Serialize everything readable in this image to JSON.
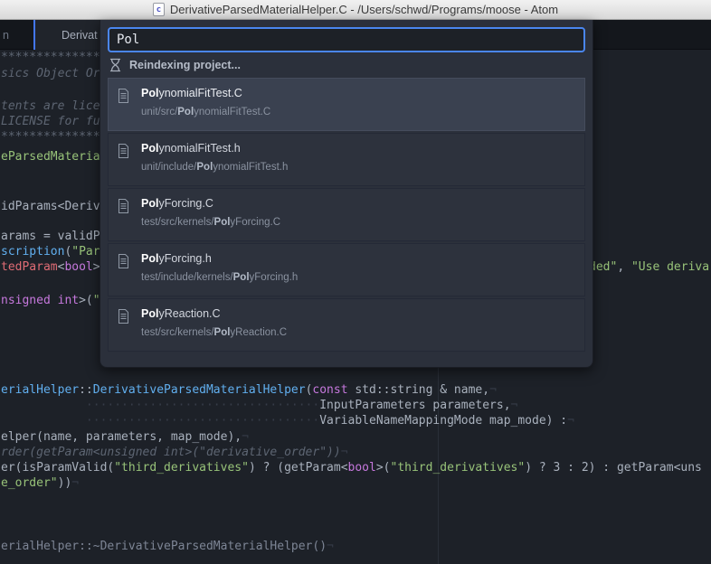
{
  "title_bar": {
    "title": "DerivativeParsedMaterialHelper.C - /Users/schwd/Programs/moose - Atom",
    "icon_letter": "c"
  },
  "tab_bar": {
    "left_tab_fragment": "n",
    "active_tab_fragment": "Derivat"
  },
  "finder": {
    "query": "Pol",
    "status": "Reindexing project...",
    "results": [
      {
        "selected": true,
        "match": "Pol",
        "rest": "ynomialFitTest.C",
        "dir": "unit/src/",
        "path_match": "Pol",
        "path_rest": "ynomialFitTest.C"
      },
      {
        "selected": false,
        "match": "Pol",
        "rest": "ynomialFitTest.h",
        "dir": "unit/include/",
        "path_match": "Pol",
        "path_rest": "ynomialFitTest.h"
      },
      {
        "selected": false,
        "match": "Pol",
        "rest": "yForcing.C",
        "dir": "test/src/kernels/",
        "path_match": "Pol",
        "path_rest": "yForcing.C"
      },
      {
        "selected": false,
        "match": "Pol",
        "rest": "yForcing.h",
        "dir": "test/include/kernels/",
        "path_match": "Pol",
        "path_rest": "yForcing.h"
      },
      {
        "selected": false,
        "match": "Pol",
        "rest": "yReaction.C",
        "dir": "test/src/kernels/",
        "path_match": "Pol",
        "path_rest": "yReaction.C"
      }
    ]
  },
  "editor": {
    "lines": [
      {
        "segments": [
          {
            "t": "**************",
            "c": "cm"
          }
        ]
      },
      {
        "segments": [
          {
            "t": "sics Object Or",
            "c": "cm"
          }
        ]
      },
      {
        "segments": [
          {
            "t": "tents are lice",
            "c": "cm"
          }
        ]
      },
      {
        "segments": [
          {
            "t": "LICENSE for fu",
            "c": "cm"
          }
        ]
      },
      {
        "segments": [
          {
            "t": "**************",
            "c": "cm"
          }
        ]
      },
      {
        "segments": [
          {
            "t": "eParsedMateria",
            "c": "grn"
          }
        ]
      },
      {
        "segments": [
          {
            "t": "idParams<Deriv",
            "c": "txt"
          }
        ]
      },
      {
        "segments": [
          {
            "t": "arams = validP",
            "c": "txt"
          }
        ]
      },
      {
        "segments": [
          {
            "t": "scription",
            "c": "fnc"
          },
          {
            "t": "(",
            "c": "txt"
          },
          {
            "t": "\"Par",
            "c": "grn"
          }
        ]
      },
      {
        "segments": [
          {
            "t": "tedParam",
            "c": "red"
          },
          {
            "t": "<",
            "c": "txt"
          },
          {
            "t": "bool",
            "c": "pur"
          },
          {
            "t": ">",
            "c": "txt"
          }
        ]
      },
      {
        "segments": [
          {
            "t": "ded\"",
            "c": "grn"
          },
          {
            "t": ", ",
            "c": "txt"
          },
          {
            "t": "\"Use deriva",
            "c": "grn"
          }
        ]
      },
      {
        "segments": [
          {
            "t": "nsigned int",
            "c": "pur"
          },
          {
            "t": ">(",
            "c": "txt"
          },
          {
            "t": "\"",
            "c": "grn"
          }
        ]
      },
      {
        "segments": [
          {
            "t": "erialHelper",
            "c": "fnc"
          },
          {
            "t": "::",
            "c": "txt"
          },
          {
            "t": "DerivativeParsedMaterialHelper",
            "c": "fnc"
          },
          {
            "t": "(",
            "c": "txt"
          },
          {
            "t": "const",
            "c": "pur"
          },
          {
            "t": " std::string & name,",
            "c": "txt"
          },
          {
            "t": "¬",
            "c": "inv"
          }
        ]
      },
      {
        "segments": [
          {
            "t": "            ",
            "c": "txt"
          },
          {
            "t": "·································",
            "c": "inv"
          },
          {
            "t": "InputParameters parameters,",
            "c": "txt"
          },
          {
            "t": "¬",
            "c": "inv"
          }
        ]
      },
      {
        "segments": [
          {
            "t": "            ",
            "c": "txt"
          },
          {
            "t": "·································",
            "c": "inv"
          },
          {
            "t": "VariableNameMappingMode map_mode) :",
            "c": "txt"
          },
          {
            "t": "¬",
            "c": "inv"
          }
        ]
      },
      {
        "segments": [
          {
            "t": "elper(name, parameters, map_mode),",
            "c": "txt"
          },
          {
            "t": "¬",
            "c": "inv"
          }
        ]
      },
      {
        "segments": [
          {
            "t": "rder(getParam<unsigned int>(\"derivative_order\"))",
            "c": "cm"
          },
          {
            "t": "¬",
            "c": "inv"
          }
        ]
      },
      {
        "segments": [
          {
            "t": "er(isParamValid(",
            "c": "txt"
          },
          {
            "t": "\"third_derivatives\"",
            "c": "grn"
          },
          {
            "t": ") ? (getParam<",
            "c": "txt"
          },
          {
            "t": "bool",
            "c": "pur"
          },
          {
            "t": ">(",
            "c": "txt"
          },
          {
            "t": "\"third_derivatives\"",
            "c": "grn"
          },
          {
            "t": ") ? 3 : 2) : getParam<uns",
            "c": "txt"
          }
        ]
      },
      {
        "segments": [
          {
            "t": "e_order\"",
            "c": "grn"
          },
          {
            "t": "))",
            "c": "txt"
          },
          {
            "t": "¬",
            "c": "inv"
          }
        ]
      },
      {
        "segments": [
          {
            "t": "erialHelper::~DerivativeParsedMaterialHelper()",
            "c": "dim"
          },
          {
            "t": "¬",
            "c": "inv"
          }
        ]
      }
    ]
  }
}
